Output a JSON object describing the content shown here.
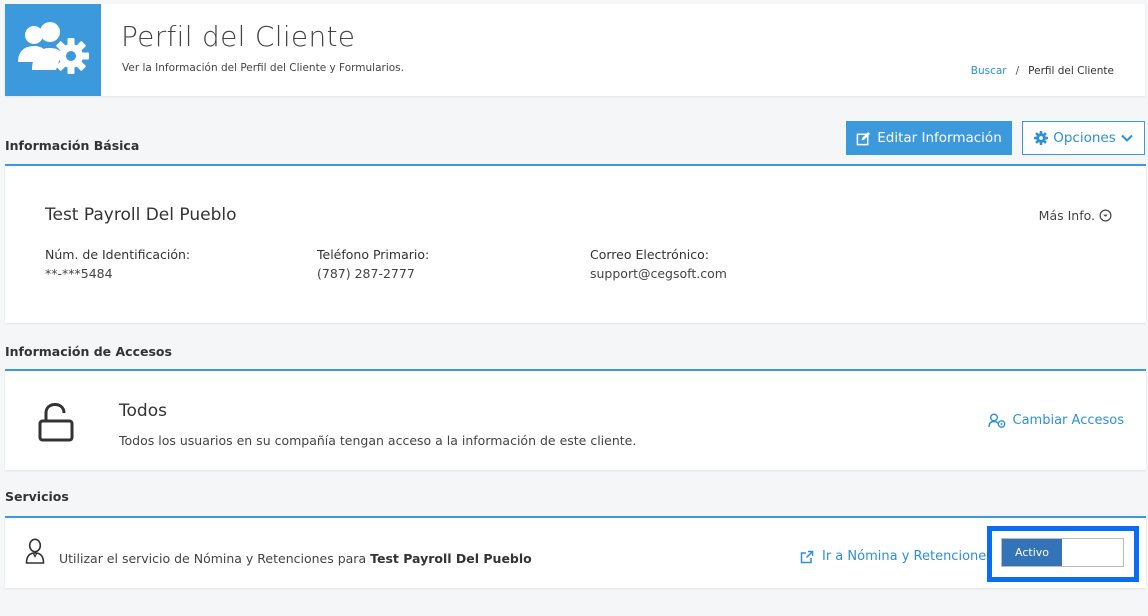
{
  "header": {
    "title": "Perfil del Cliente",
    "subtitle": "Ver la Información del Perfil del Cliente y Formularios.",
    "breadcrumb": {
      "link": "Buscar",
      "separator": "/",
      "current": "Perfil del Cliente"
    },
    "icon": "users-gear-icon"
  },
  "basic_info": {
    "section_title": "Información Básica",
    "edit_button": "Editar Información",
    "options_button": "Opciones",
    "client_name": "Test Payroll Del Pueblo",
    "more_info": "Más Info.",
    "fields": [
      {
        "label": "Núm. de Identificación:",
        "value": "**-***5484"
      },
      {
        "label": "Teléfono Primario:",
        "value": "(787) 287-2777"
      },
      {
        "label": "Correo Electrónico:",
        "value": "support@cegsoft.com"
      }
    ]
  },
  "access_info": {
    "section_title": "Información de Accesos",
    "title": "Todos",
    "description": "Todos los usuarios en su compañía tengan acceso a la información de este cliente.",
    "change_link": "Cambiar Accesos"
  },
  "services": {
    "section_title": "Servicios",
    "text_prefix": "Utilizar el servicio de Nómina y Retenciones para",
    "client_name": "Test Payroll Del Pueblo",
    "link": "Ir a Nómina y Retenciones",
    "toggle_label": "Activo"
  },
  "colors": {
    "accent": "#3c99dc",
    "link": "#2d8fd8",
    "toggle_on": "#3573b8",
    "highlight": "#0a6cf2"
  }
}
